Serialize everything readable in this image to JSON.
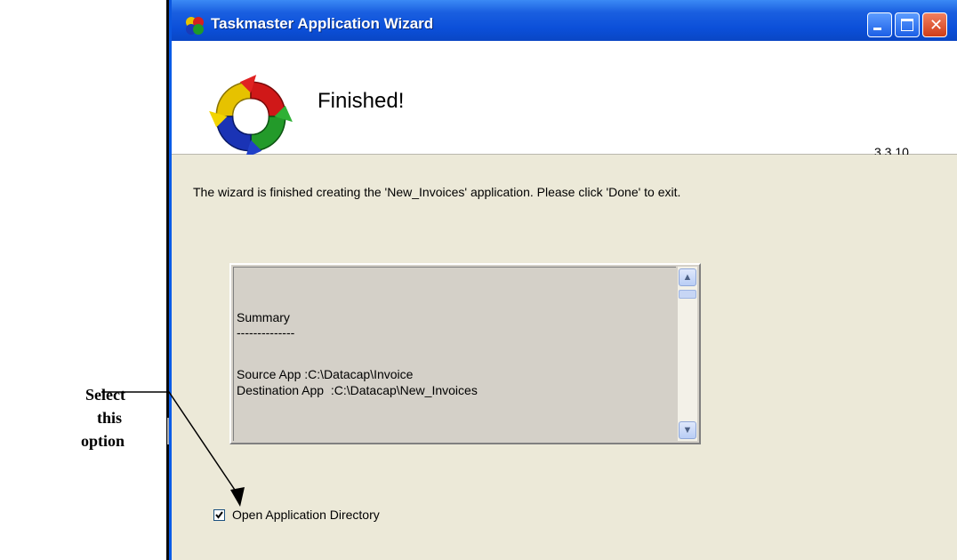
{
  "window": {
    "title": "Taskmaster Application Wizard"
  },
  "header": {
    "title": "Finished!",
    "version": "3.3.10"
  },
  "body": {
    "message": "The wizard is finished creating the 'New_Invoices' application. Please click 'Done' to exit."
  },
  "summary": {
    "lines": [
      "Summary",
      "--------------",
      "",
      "Source App :C:\\Datacap\\Invoice",
      "Destination App  :C:\\Datacap\\New_Invoices"
    ]
  },
  "checkbox": {
    "label": "Open Application Directory",
    "checked": true
  },
  "annotation": {
    "lines": [
      "Select",
      "this",
      "option"
    ]
  }
}
